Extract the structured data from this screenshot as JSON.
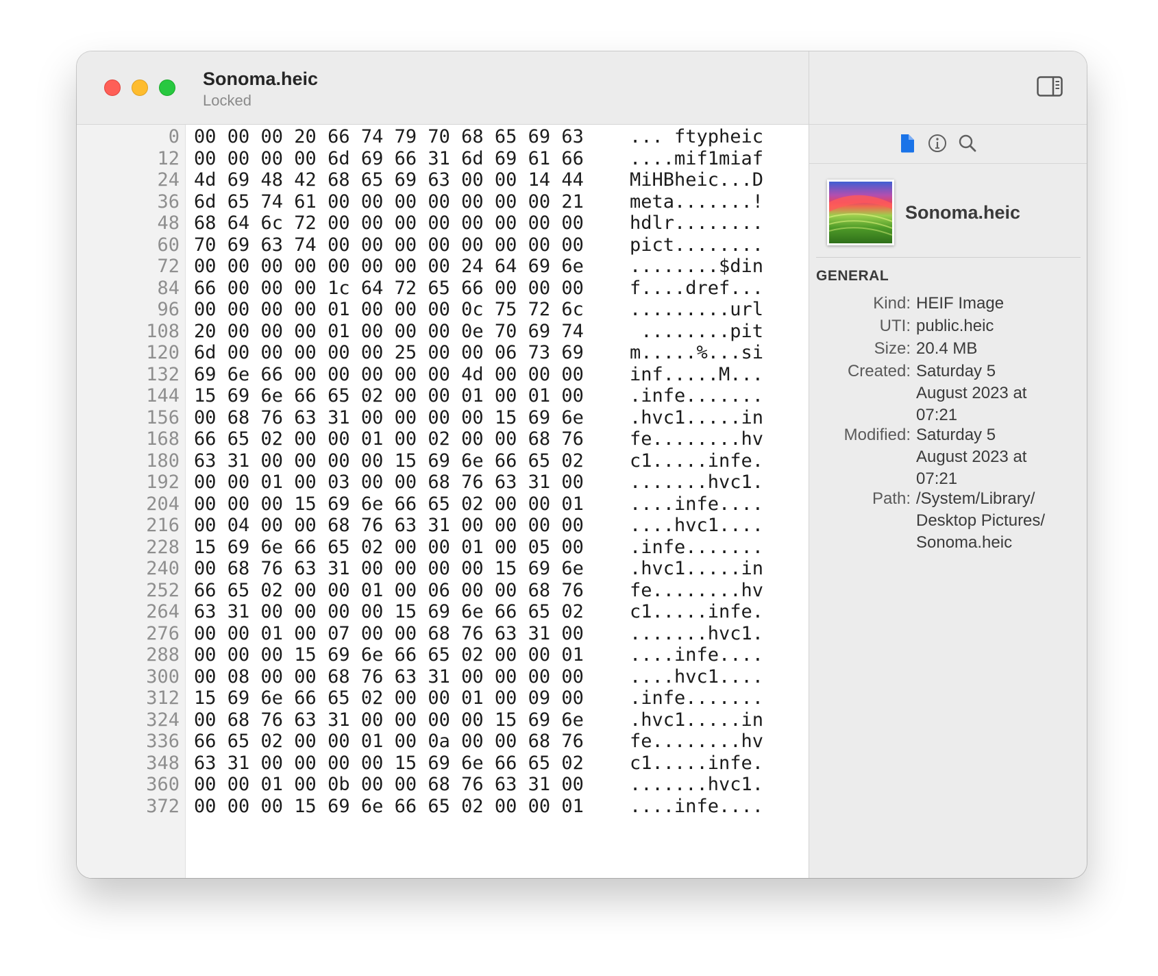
{
  "window": {
    "title": "Sonoma.heic",
    "subtitle": "Locked"
  },
  "hex_rows": [
    {
      "offset": "0",
      "bytes": "00 00 00 20 66 74 79 70 68 65 69 63",
      "ascii": "... ftypheic"
    },
    {
      "offset": "12",
      "bytes": "00 00 00 00 6d 69 66 31 6d 69 61 66",
      "ascii": "....mif1miaf"
    },
    {
      "offset": "24",
      "bytes": "4d 69 48 42 68 65 69 63 00 00 14 44",
      "ascii": "MiHBheic...D"
    },
    {
      "offset": "36",
      "bytes": "6d 65 74 61 00 00 00 00 00 00 00 21",
      "ascii": "meta.......!"
    },
    {
      "offset": "48",
      "bytes": "68 64 6c 72 00 00 00 00 00 00 00 00",
      "ascii": "hdlr........"
    },
    {
      "offset": "60",
      "bytes": "70 69 63 74 00 00 00 00 00 00 00 00",
      "ascii": "pict........"
    },
    {
      "offset": "72",
      "bytes": "00 00 00 00 00 00 00 00 24 64 69 6e",
      "ascii": "........$din"
    },
    {
      "offset": "84",
      "bytes": "66 00 00 00 1c 64 72 65 66 00 00 00",
      "ascii": "f....dref..."
    },
    {
      "offset": "96",
      "bytes": "00 00 00 00 01 00 00 00 0c 75 72 6c",
      "ascii": ".........url"
    },
    {
      "offset": "108",
      "bytes": "20 00 00 00 01 00 00 00 0e 70 69 74",
      "ascii": " ........pit"
    },
    {
      "offset": "120",
      "bytes": "6d 00 00 00 00 00 25 00 00 06 73 69",
      "ascii": "m.....%...si"
    },
    {
      "offset": "132",
      "bytes": "69 6e 66 00 00 00 00 00 4d 00 00 00",
      "ascii": "inf.....M..."
    },
    {
      "offset": "144",
      "bytes": "15 69 6e 66 65 02 00 00 01 00 01 00",
      "ascii": ".infe......."
    },
    {
      "offset": "156",
      "bytes": "00 68 76 63 31 00 00 00 00 15 69 6e",
      "ascii": ".hvc1.....in"
    },
    {
      "offset": "168",
      "bytes": "66 65 02 00 00 01 00 02 00 00 68 76",
      "ascii": "fe........hv"
    },
    {
      "offset": "180",
      "bytes": "63 31 00 00 00 00 15 69 6e 66 65 02",
      "ascii": "c1.....infe."
    },
    {
      "offset": "192",
      "bytes": "00 00 01 00 03 00 00 68 76 63 31 00",
      "ascii": ".......hvc1."
    },
    {
      "offset": "204",
      "bytes": "00 00 00 15 69 6e 66 65 02 00 00 01",
      "ascii": "....infe...."
    },
    {
      "offset": "216",
      "bytes": "00 04 00 00 68 76 63 31 00 00 00 00",
      "ascii": "....hvc1...."
    },
    {
      "offset": "228",
      "bytes": "15 69 6e 66 65 02 00 00 01 00 05 00",
      "ascii": ".infe......."
    },
    {
      "offset": "240",
      "bytes": "00 68 76 63 31 00 00 00 00 15 69 6e",
      "ascii": ".hvc1.....in"
    },
    {
      "offset": "252",
      "bytes": "66 65 02 00 00 01 00 06 00 00 68 76",
      "ascii": "fe........hv"
    },
    {
      "offset": "264",
      "bytes": "63 31 00 00 00 00 15 69 6e 66 65 02",
      "ascii": "c1.....infe."
    },
    {
      "offset": "276",
      "bytes": "00 00 01 00 07 00 00 68 76 63 31 00",
      "ascii": ".......hvc1."
    },
    {
      "offset": "288",
      "bytes": "00 00 00 15 69 6e 66 65 02 00 00 01",
      "ascii": "....infe...."
    },
    {
      "offset": "300",
      "bytes": "00 08 00 00 68 76 63 31 00 00 00 00",
      "ascii": "....hvc1...."
    },
    {
      "offset": "312",
      "bytes": "15 69 6e 66 65 02 00 00 01 00 09 00",
      "ascii": ".infe......."
    },
    {
      "offset": "324",
      "bytes": "00 68 76 63 31 00 00 00 00 15 69 6e",
      "ascii": ".hvc1.....in"
    },
    {
      "offset": "336",
      "bytes": "66 65 02 00 00 01 00 0a 00 00 68 76",
      "ascii": "fe........hv"
    },
    {
      "offset": "348",
      "bytes": "63 31 00 00 00 00 15 69 6e 66 65 02",
      "ascii": "c1.....infe."
    },
    {
      "offset": "360",
      "bytes": "00 00 01 00 0b 00 00 68 76 63 31 00",
      "ascii": ".......hvc1."
    },
    {
      "offset": "372",
      "bytes": "00 00 00 15 69 6e 66 65 02 00 00 01",
      "ascii": "....infe...."
    }
  ],
  "inspector": {
    "tabs": [
      {
        "icon": "document-icon",
        "active": true
      },
      {
        "icon": "info-icon",
        "active": false
      },
      {
        "icon": "search-icon",
        "active": false
      }
    ],
    "file_name": "Sonoma.heic",
    "section_title": "GENERAL",
    "info": [
      {
        "label": "Kind:",
        "lines": [
          "HEIF Image"
        ]
      },
      {
        "label": "UTI:",
        "lines": [
          "public.heic"
        ]
      },
      {
        "label": "Size:",
        "lines": [
          "20.4 MB"
        ]
      },
      {
        "label": "Created:",
        "lines": [
          "Saturday 5",
          "August 2023 at",
          "07:21"
        ]
      },
      {
        "label": "Modified:",
        "lines": [
          "Saturday 5",
          "August 2023 at",
          "07:21"
        ]
      },
      {
        "label": "Path:",
        "lines": [
          "/System/Library/",
          "Desktop Pictures/",
          "Sonoma.heic"
        ]
      }
    ]
  },
  "colors": {
    "accent": "#1a73e8"
  }
}
